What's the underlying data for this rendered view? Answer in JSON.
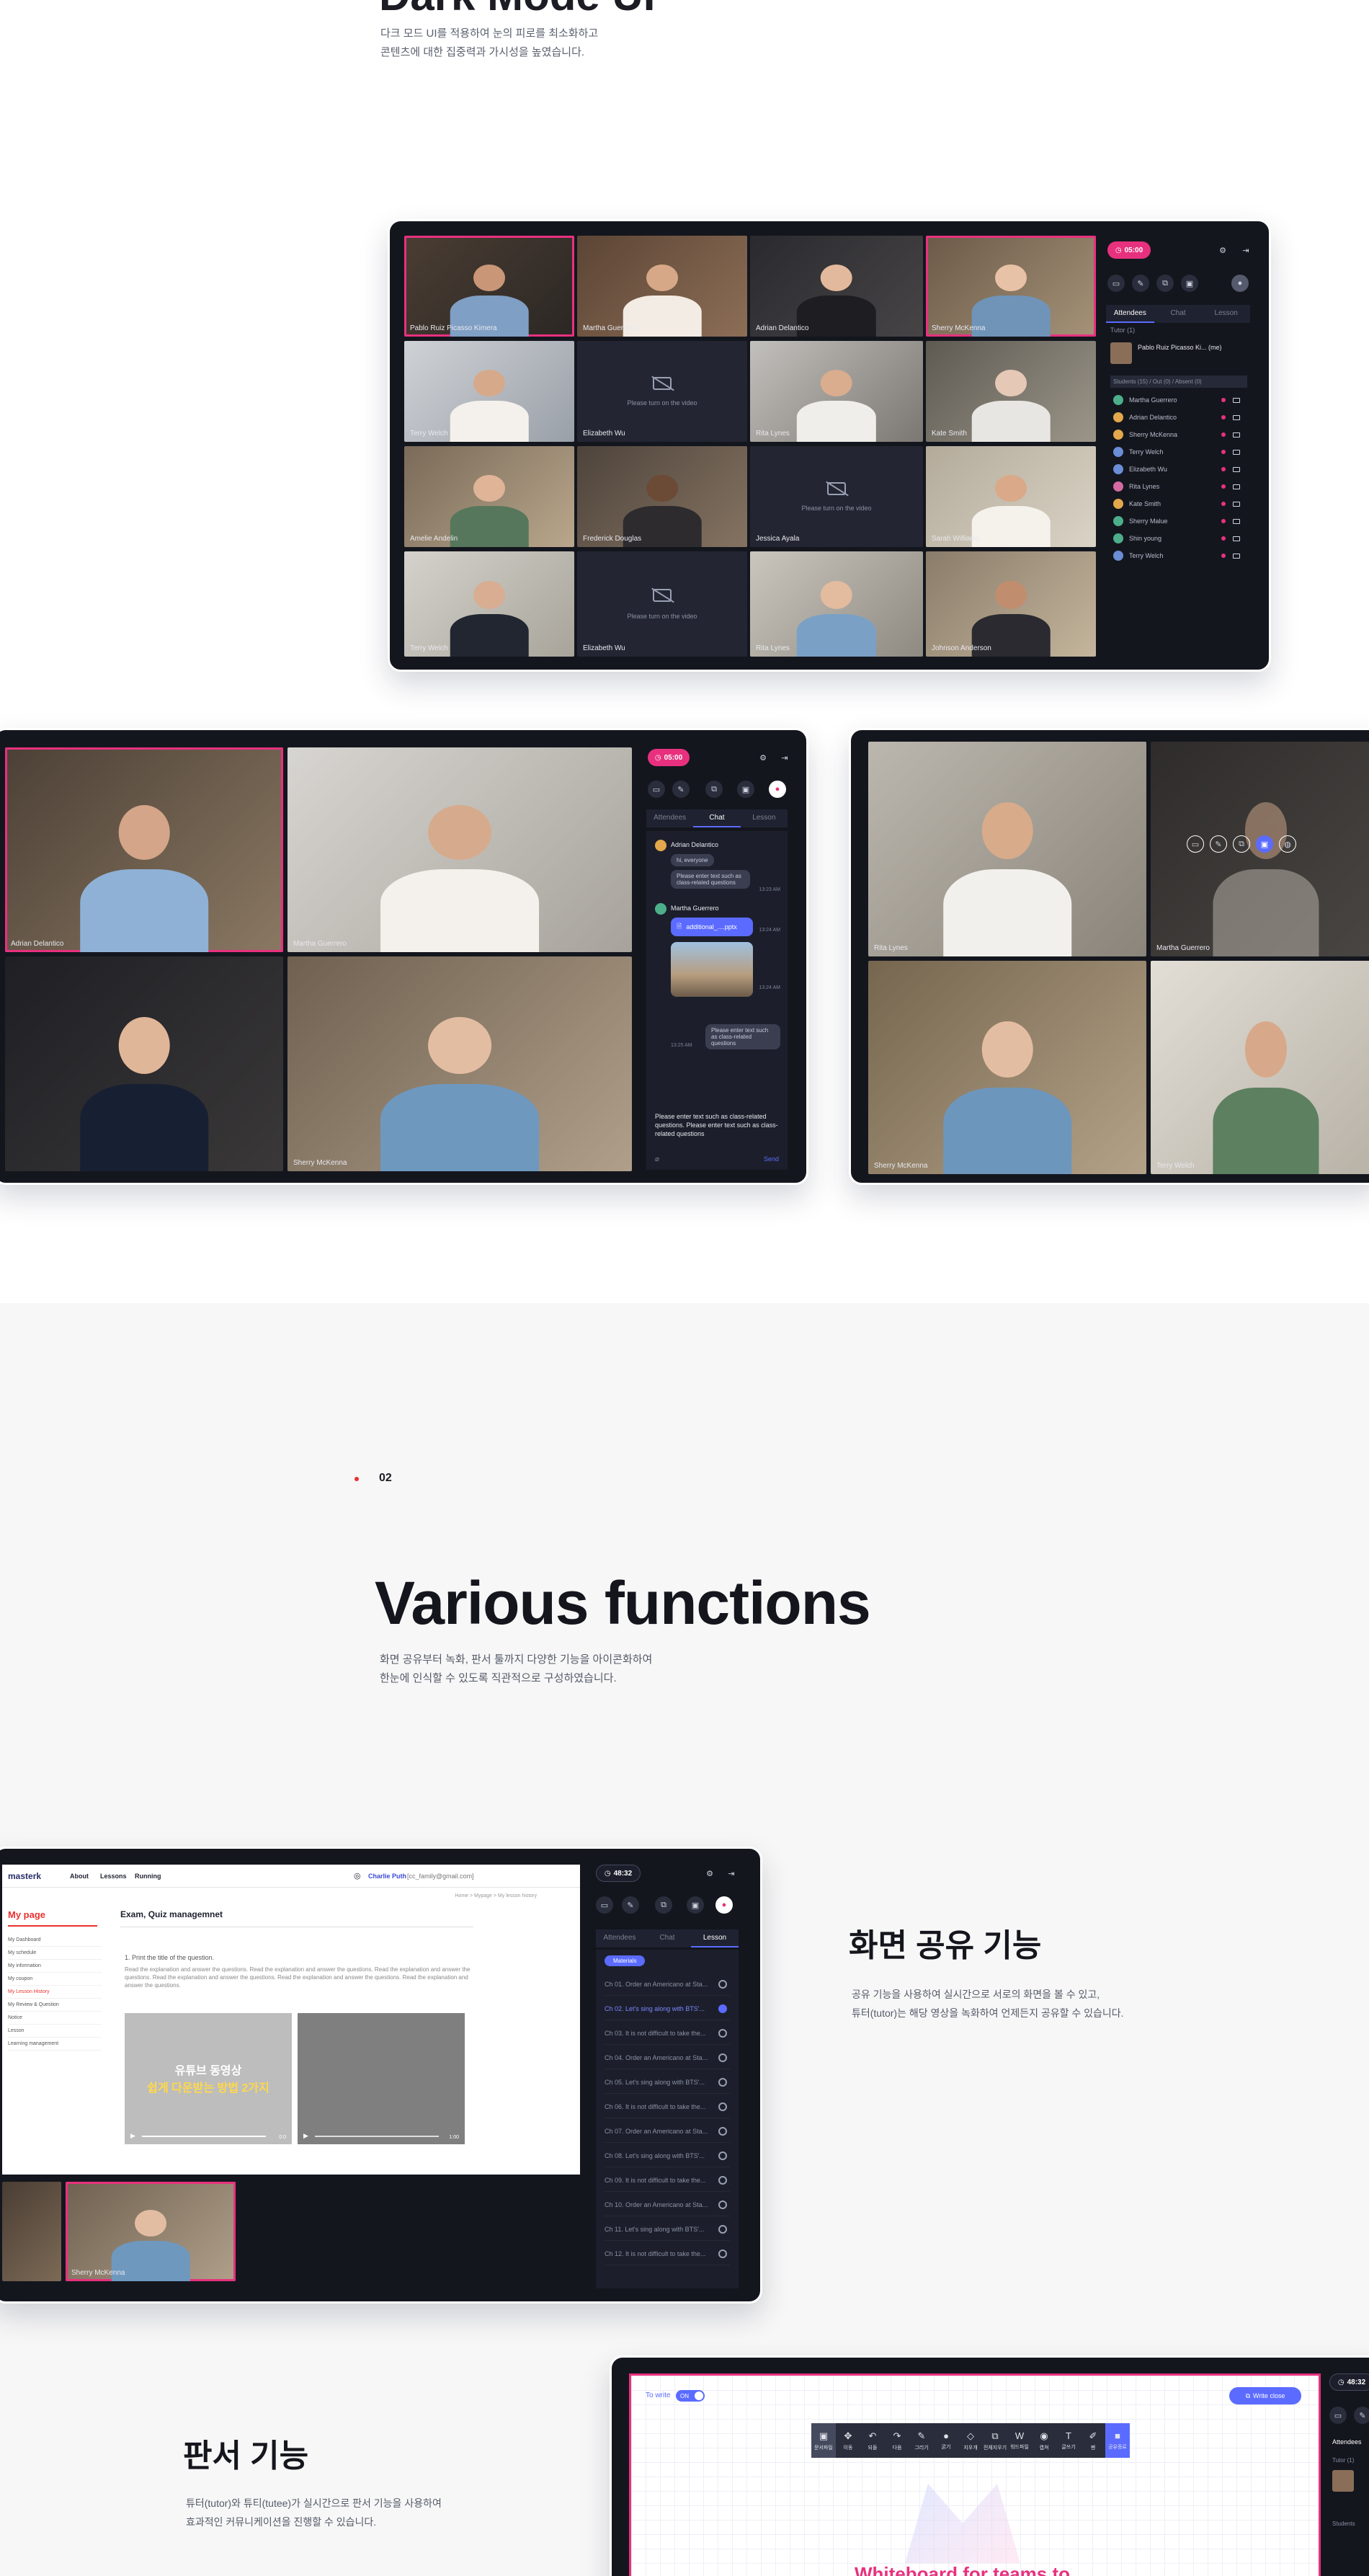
{
  "intro": {
    "title": "Dark Mode UI",
    "desc_line1": "다크 모드 UI를 적용하여 눈의 피로를 최소화하고",
    "desc_line2": "콘텐츠에 대한 집중력과 가시성을 높였습니다."
  },
  "classroom": {
    "timer": "05:00",
    "video_off_msg": "Please turn on the video",
    "tiles": [
      "Pablo Ruiz Picasso Kimera",
      "Martha Guerrero",
      "Adrian Delantico",
      "Sherry McKenna",
      "Terry Welch",
      "Elizabeth Wu",
      "Rita Lynes",
      "Kate Smith",
      "Amelie Andelin",
      "Frederick Douglas",
      "Jessica Ayala",
      "Sarah Williams",
      "Terry Welch",
      "Elizabeth Wu",
      "Rita Lynes",
      "Johnson Anderson"
    ],
    "tabs": [
      "Attendees",
      "Chat",
      "Lesson"
    ],
    "tutor_label": "Tutor (1)",
    "tutor_name": "Pablo Ruiz Picasso Ki... (me)",
    "students_label": "Students (15) / Out (0) / Absent (0)",
    "students": [
      "Martha Guerrero",
      "Adrian Delantico",
      "Sherry McKenna",
      "Terry Welch",
      "Elizabeth Wu",
      "Rita Lynes",
      "Kate Smith",
      "Sherry Malue",
      "Shin young",
      "Terry Welch"
    ]
  },
  "chat_frame": {
    "timer": "05:00",
    "tabs": [
      "Attendees",
      "Chat",
      "Lesson"
    ],
    "tiles": [
      "Adrian Delantico",
      "Martha Guerrero",
      "Sherry McKenna"
    ],
    "sender1": "Adrian Delantico",
    "msg1": "hi, everyone",
    "msg2": "Please enter text such as class-related questions",
    "time1": "13:23 AM",
    "sender2": "Martha Guerrero",
    "file": "additional_....pptx",
    "time2": "13:24 AM",
    "time3": "13:24 AM",
    "msg3": "Please enter text such as class-related questions",
    "time4": "13:25 AM",
    "input_text": "Please enter text such as class-related questions. Please enter text such as class-related questions",
    "send": "Send"
  },
  "grid_frame": {
    "tiles": [
      "Rita Lynes",
      "Martha Guerrero",
      "Sherry McKenna",
      "Terry Welch"
    ]
  },
  "section2": {
    "num": "02",
    "title": "Various functions",
    "desc_line1": "화면 공유부터 녹화, 판서 툴까지 다양한 기능을 아이콘화하여",
    "desc_line2": "한눈에 인식할 수 있도록 직관적으로 구성하였습니다."
  },
  "screen_share": {
    "title": "화면 공유 기능",
    "desc_line1": "공유 기능을 사용하여 실시간으로 서로의 화면을 볼 수 있고,",
    "desc_line2": "튜터(tutor)는 해당 영상을 녹화하여 언제든지 공유할 수 있습니다.",
    "timer": "48:32",
    "logo": "masterk",
    "nav": [
      "About",
      "Lessons",
      "Running"
    ],
    "user": "Charlie Puth",
    "user_email": "[cc_family@gmail.com]",
    "breadcrumb": "Home > Mypage > My lesson history",
    "side_title": "My page",
    "side_items": [
      "My Dashboard",
      "My schedule",
      "My information",
      "My coupon",
      "My Lesson History",
      "My Review & Question",
      "Notice",
      "Lesson",
      "Learning management"
    ],
    "content_title": "Exam, Quiz managemnet",
    "question": "1. Print the title of the question.",
    "question_body": "Read the explanation and answer the questions. Read the explanation and answer the questions. Read the explanation and answer the questions. Read the explanation and answer the questions. Read the explanation and answer the questions. Read the explanation and answer the questions.",
    "video_line1": "유튜브 동영상",
    "video_line2": "쉽게 다운받는 방법 2가지",
    "video_time1": "0:0",
    "video_time2": "1:00",
    "tabs": [
      "Attendees",
      "Chat",
      "Lesson"
    ],
    "materials": "Materials",
    "lessons": [
      "Ch 01. Order an Americano at Sta...",
      "Ch 02. Let's sing along with BTS'...",
      "Ch 03. It is not difficult to take the...",
      "Ch 04. Order an Americano at Sta...",
      "Ch 05. Let's sing along with BTS'...",
      "Ch 06. It is not difficult to take the...",
      "Ch 07. Order an Americano at Sta...",
      "Ch 08. Let's sing along with BTS'...",
      "Ch 09. It is not difficult to take the...",
      "Ch 10. Order an Americano at Sta...",
      "Ch 11. Let's sing along with BTS'...",
      "Ch 12. It is not difficult to take the..."
    ],
    "thumb_name": "Sherry McKenna"
  },
  "whiteboard": {
    "title": "판서 기능",
    "desc_line1": "튜터(tutor)와 튜티(tutee)가 실시간으로 판서 기능을 사용하여",
    "desc_line2": "효과적인 커뮤니케이션을 진행할 수 있습니다.",
    "to_write": "To write",
    "toggle": "ON",
    "write_close": "Write close",
    "tools": [
      "문서파일",
      "이동",
      "되돌",
      "다음",
      "그리기",
      "굵기",
      "지우개",
      "전체지우기",
      "워드파일",
      "캡쳐",
      "글쓰기",
      "펜",
      "공유종료"
    ],
    "canvas_text": "Whiteboard for teams to",
    "timer": "48:32",
    "attendees": "Attendees",
    "tutor": "Tutor (1)",
    "students": "Students"
  },
  "colors": {
    "accent": "#e8317e",
    "blue": "#5b6bff",
    "dark": "#14161e",
    "red_dot": "#e8312f"
  }
}
